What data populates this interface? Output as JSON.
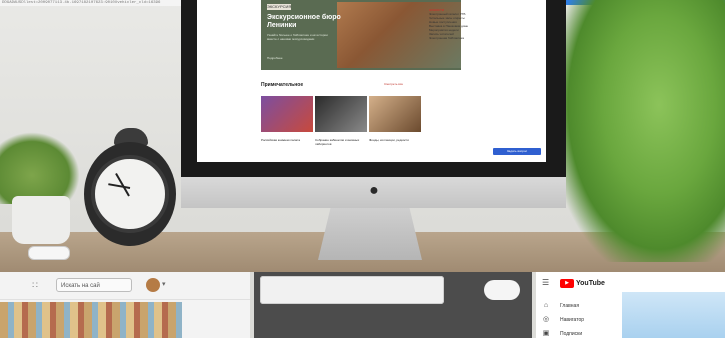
{
  "browser": {
    "url_text": "DDGADAUSDllest=2009077113.4b.1697182107623:9010Uvehicler_cld=16396"
  },
  "screen": {
    "hero": {
      "badge": "ЭКСКУРСИЯ",
      "title": "Экскурсионное бюро Ленинки",
      "text": "Узнайте больше о библиотеке и её истории вместе с нашими экскурсоводами",
      "link": "Подробнее"
    },
    "section": {
      "title": "Примечательное",
      "more": "Смотреть все"
    },
    "cards": [
      {
        "caption": "Российская книжная палата"
      },
      {
        "caption": "Собрание кабинетов и книжных лабиринтов"
      },
      {
        "caption": "Фонды, коллекции, редкости"
      }
    ],
    "sidebar": {
      "heading": "НОВОСТИ",
      "lines": [
        "Электронный каталог РГБ",
        "Читальные залы открыты",
        "Новые поступления",
        "Выставка в Пашковом доме",
        "Мероприятия недели",
        "Запись читателей",
        "Электронная библиотека"
      ]
    },
    "cta_button": "Задать вопрос"
  },
  "bottom_left": {
    "search_placeholder": "Искать на сай",
    "apps_icon": "apps-icon"
  },
  "youtube": {
    "logo_text": "YouTube",
    "menu": [
      {
        "icon": "home-icon",
        "label": "Главная"
      },
      {
        "icon": "explore-icon",
        "label": "Навигатор"
      },
      {
        "icon": "subscriptions-icon",
        "label": "Подписки"
      }
    ]
  },
  "colors": {
    "accent_red": "#c0382f",
    "cta_blue": "#2f5fd0",
    "hero_green": "#5a6b52",
    "youtube_red": "#ff0000"
  }
}
